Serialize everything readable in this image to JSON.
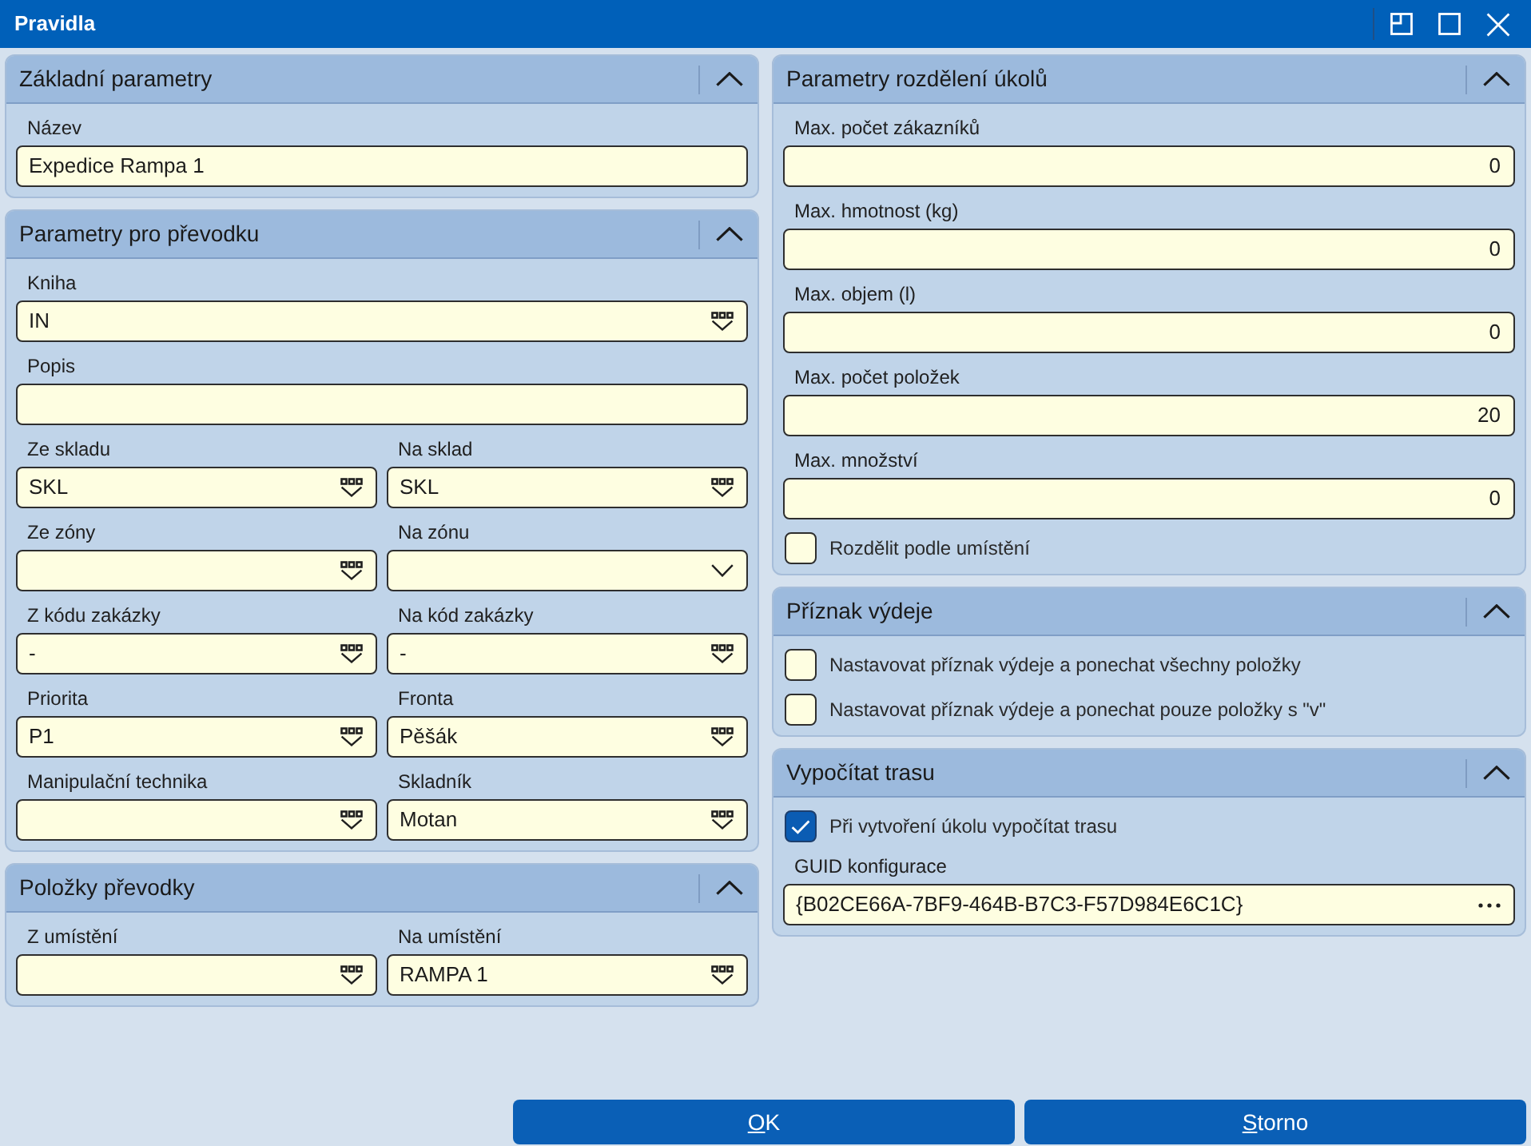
{
  "window": {
    "title": "Pravidla"
  },
  "columns": [
    {
      "panels": [
        {
          "title": "Základní parametry",
          "expanded": true,
          "rows": [
            [
              {
                "kind": "text",
                "label": "Název",
                "value": "Expedice Rampa 1"
              }
            ]
          ]
        },
        {
          "title": "Parametry pro převodku",
          "expanded": true,
          "rows": [
            [
              {
                "kind": "lookup",
                "label": "Kniha",
                "value": "IN"
              }
            ],
            [
              {
                "kind": "text",
                "label": "Popis"
              }
            ],
            [
              {
                "kind": "lookup",
                "label": "Ze skladu",
                "value": "SKL"
              },
              {
                "kind": "lookup",
                "label": "Na sklad",
                "value": "SKL"
              }
            ],
            [
              {
                "kind": "lookup",
                "label": "Ze zóny"
              },
              {
                "kind": "dropdown",
                "label": "Na zónu"
              }
            ],
            [
              {
                "kind": "lookup",
                "label": "Z kódu zakázky",
                "value": "-"
              },
              {
                "kind": "lookup",
                "label": "Na kód zakázky",
                "value": "-"
              }
            ],
            [
              {
                "kind": "lookup",
                "label": "Priorita",
                "value": "P1"
              },
              {
                "kind": "lookup",
                "label": "Fronta",
                "value": "Pěšák"
              }
            ],
            [
              {
                "kind": "lookup",
                "label": "Manipulační technika"
              },
              {
                "kind": "lookup",
                "label": "Skladník",
                "value": "Motan"
              }
            ]
          ]
        },
        {
          "title": "Položky převodky",
          "expanded": true,
          "rows": [
            [
              {
                "kind": "lookup",
                "label": "Z umístění"
              },
              {
                "kind": "lookup",
                "label": "Na umístění",
                "value": "RAMPA 1"
              }
            ]
          ]
        }
      ]
    },
    {
      "panels": [
        {
          "title": "Parametry rozdělení úkolů",
          "expanded": true,
          "rows": [
            [
              {
                "kind": "number",
                "label": "Max. počet zákazníků",
                "value": "0"
              }
            ],
            [
              {
                "kind": "number",
                "label": "Max. hmotnost (kg)",
                "value": "0"
              }
            ],
            [
              {
                "kind": "number",
                "label": "Max. objem (l)",
                "value": "0"
              }
            ],
            [
              {
                "kind": "number",
                "label": "Max. počet položek",
                "value": "20"
              }
            ],
            [
              {
                "kind": "number",
                "label": "Max. množství",
                "value": "0"
              }
            ],
            [
              {
                "kind": "checkbox",
                "label": "Rozdělit podle umístění",
                "checked": false
              }
            ]
          ]
        },
        {
          "title": "Příznak výdeje",
          "expanded": true,
          "rows": [
            [
              {
                "kind": "checkbox",
                "label": "Nastavovat příznak výdeje a ponechat všechny položky",
                "checked": false
              }
            ],
            [
              {
                "kind": "checkbox",
                "label": "Nastavovat příznak výdeje a ponechat pouze položky s \"v\"",
                "checked": false
              }
            ]
          ]
        },
        {
          "title": "Vypočítat trasu",
          "expanded": true,
          "rows": [
            [
              {
                "kind": "checkbox",
                "label": "Při vytvoření úkolu vypočítat trasu",
                "checked": true
              }
            ],
            [
              {
                "kind": "browse",
                "label": "GUID konfigurace",
                "value": "{B02CE66A-7BF9-464B-B7C3-F57D984E6C1C}"
              }
            ]
          ]
        }
      ]
    }
  ],
  "buttons": [
    {
      "label": "OK"
    },
    {
      "label": "Storno"
    }
  ]
}
